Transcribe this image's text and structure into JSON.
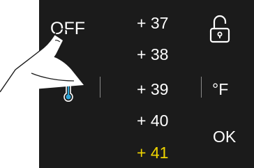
{
  "panel": {
    "off_label": "OFF",
    "unit_label": "°F",
    "ok_label": "OK",
    "temperatures": [
      "+ 37",
      "+ 38",
      "+ 39",
      "+ 40",
      "+ 41"
    ],
    "selected_temperature": "+ 41",
    "icons": {
      "lock": "padlock-unlocked-icon",
      "thermometer": "thermometer-icon",
      "hand": "pointing-hand-icon"
    },
    "colors": {
      "background": "#1b1b1b",
      "text": "#ffffff",
      "selected": "#f0d500"
    }
  }
}
